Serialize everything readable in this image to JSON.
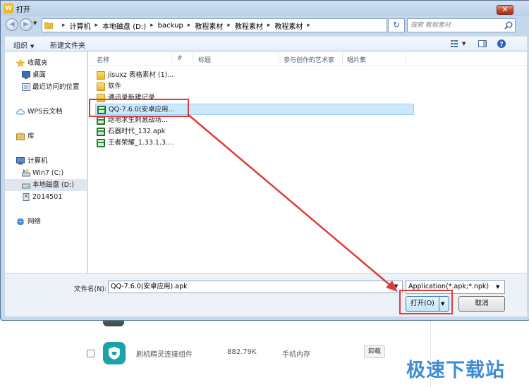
{
  "background_app": {
    "row": {
      "name": "刷机精灵连接组件",
      "size": "882.79K",
      "location": "手机内存",
      "uninstall_label": "卸载"
    },
    "watermark": "极速下载站"
  },
  "dialog": {
    "title": "打开",
    "title_icon_letter": "W",
    "close_glyph": "✕",
    "nav": {
      "back_glyph": "◀",
      "forward_glyph": "▶",
      "breadcrumbs": [
        "计算机",
        "本地磁盘 (D:)",
        "backup",
        "教程素材",
        "教程素材",
        "教程素材"
      ],
      "separator": "▸",
      "refresh_glyph": "↻",
      "search_placeholder": "搜索 教程素材"
    },
    "toolbar": {
      "organize_label": "组织",
      "new_folder_label": "新建文件夹",
      "caret": "▼"
    },
    "sidebar": {
      "items": [
        {
          "label": "收藏夹",
          "icon": "star-icon"
        },
        {
          "label": "桌面",
          "icon": "desktop-icon"
        },
        {
          "label": "最近访问的位置",
          "icon": "recent-places-icon"
        },
        {
          "label": "WPS云文档",
          "icon": "cloud-icon"
        },
        {
          "label": "库",
          "icon": "library-icon"
        },
        {
          "label": "计算机",
          "icon": "computer-icon"
        },
        {
          "label": "Win7 (C:)",
          "icon": "drive-c-icon"
        },
        {
          "label": "本地磁盘 (D:)",
          "icon": "drive-d-icon",
          "selected": true
        },
        {
          "label": "2014501",
          "icon": "user-folder-icon"
        },
        {
          "label": "网络",
          "icon": "network-icon"
        }
      ]
    },
    "columns": [
      "名称",
      "#",
      "标题",
      "参与创作的艺术家",
      "唱片集"
    ],
    "files": [
      {
        "name": "jisuxz 表格素材 (1)...",
        "type": "folder"
      },
      {
        "name": "软件",
        "type": "folder"
      },
      {
        "name": "通讯录新建记录",
        "type": "folder"
      },
      {
        "name": "QQ-7.6.0(安卓应用...",
        "type": "apk",
        "selected": true
      },
      {
        "name": "绝地求生刺激战场...",
        "type": "apk"
      },
      {
        "name": "石器时代_132.apk",
        "type": "apk"
      },
      {
        "name": "王者荣耀_1.33.1.3....",
        "type": "apk"
      }
    ],
    "bottom": {
      "filename_label": "文件名(N):",
      "filename_value": "QQ-7.6.0(安卓应用).apk",
      "filetype_value": "Application(*.apk;*.npk)",
      "open_label": "打开(O)",
      "cancel_label": "取消",
      "dropdown_glyph": "▼"
    }
  },
  "colors": {
    "window_frame": "#c6d8ec",
    "selection": "#cce8ff",
    "highlight_annotation": "#e03b3b",
    "watermark": "#3e8dd4"
  }
}
